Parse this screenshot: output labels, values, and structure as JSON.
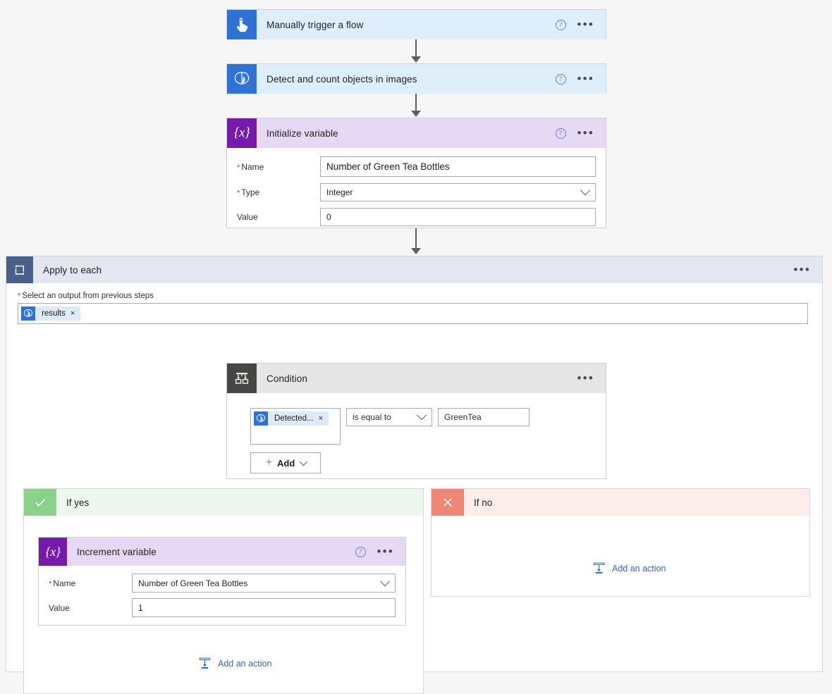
{
  "flow": {
    "steps": [
      {
        "id": "trigger",
        "title": "Manually trigger a flow",
        "icon": "tap-hand-icon",
        "theme": "blue"
      },
      {
        "id": "detect",
        "title": "Detect and count objects in images",
        "icon": "ai-brain-icon",
        "theme": "blue"
      },
      {
        "id": "init-variable",
        "title": "Initialize variable",
        "icon": "variable-braces-icon",
        "theme": "purple",
        "fields": [
          {
            "label": "Name",
            "required": true,
            "value": "Number of Green Tea Bottles",
            "control": "text"
          },
          {
            "label": "Type",
            "required": true,
            "value": "Integer",
            "control": "select"
          },
          {
            "label": "Value",
            "required": false,
            "value": "0",
            "control": "text"
          }
        ]
      }
    ]
  },
  "loop": {
    "title": "Apply to each",
    "icon": "loop-icon",
    "input_label": "Select an output from previous steps",
    "input_required": true,
    "token": {
      "label": "results",
      "icon": "ai-brain-icon",
      "remove": "×"
    }
  },
  "condition": {
    "title": "Condition",
    "icon": "condition-branch-icon",
    "operand_left": {
      "label": "Detected...",
      "icon": "ai-brain-icon",
      "remove": "×"
    },
    "operator": "is equal to",
    "operand_right": "GreenTea",
    "add_button": "Add"
  },
  "branches": {
    "yes": {
      "title": "If yes",
      "icon": "checkmark-icon",
      "action": {
        "title": "Increment variable",
        "icon": "variable-braces-icon",
        "theme": "purple",
        "fields": [
          {
            "label": "Name",
            "required": true,
            "value": "Number of Green Tea Bottles",
            "control": "select"
          },
          {
            "label": "Value",
            "required": false,
            "value": "1",
            "control": "text"
          }
        ]
      },
      "add_action_label": "Add an action"
    },
    "no": {
      "title": "If no",
      "icon": "close-x-icon",
      "add_action_label": "Add an action"
    }
  },
  "icons": {
    "help": "?",
    "ellipsis": "•••",
    "variable_braces": "{x}",
    "required_marker": "*"
  },
  "colors": {
    "canvas_background": "#f6f6f6",
    "blue_accent": "#2f72d5",
    "purple_accent": "#7719aa",
    "grey_accent": "#484644",
    "loop_accent": "#48618a",
    "yes_accent": "#8bd18b",
    "no_accent": "#ee8775",
    "link": "#3a63c8",
    "required_red": "#d13438"
  }
}
